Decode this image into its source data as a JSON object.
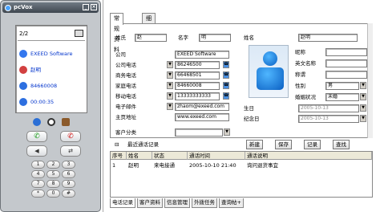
{
  "phone": {
    "app_title": "pcVox",
    "page_indicator": "2/2",
    "contacts": [
      {
        "label": "EXEED Software",
        "icon": "globe-icon",
        "color": "#2255ee"
      },
      {
        "label": "赵明",
        "icon": "contact-icon",
        "color": "#cc3333"
      },
      {
        "label": "84660008",
        "icon": "phone-icon",
        "color": "#2266dd"
      },
      {
        "label": "00:00:35",
        "icon": "clock-icon",
        "color": "#2266dd"
      }
    ],
    "keys": [
      "1",
      "2",
      "3",
      "4",
      "5",
      "6",
      "7",
      "8",
      "9",
      "*",
      "0",
      "#"
    ]
  },
  "tabs": [
    "常规资料",
    "细节资料"
  ],
  "form": {
    "salutation_label": "姓氏",
    "salutation_value": "赵",
    "given_label": "名字",
    "given_value": "明",
    "fullname_label": "姓名",
    "fullname_value": "赵明",
    "company_label": "公司",
    "company_value": "EXEED Software",
    "office_phone_label": "公司电话",
    "office_phone_value": "86246500",
    "business_phone_label": "商务电话",
    "business_phone_value": "66468501",
    "home_phone_label": "家庭电话",
    "home_phone_value": "84660008",
    "mobile_label": "移动电话",
    "mobile_value": "13333333333",
    "email_label": "电子邮件",
    "email_value": "zhaom@exeed.com",
    "homepage_label": "主页地址",
    "homepage_value": "www.exeed.com",
    "nickname_label": "昵称",
    "english_name_label": "英文名称",
    "title_label": "称谓",
    "gender_label": "性别",
    "gender_value": "男",
    "marital_label": "婚姻状况",
    "marital_value": "未婚",
    "birthday_label": "生日",
    "birthday_value": "2005-10-13",
    "anniversary_label": "纪念日",
    "anniversary_value": "2005-10-13",
    "category_label": "客户分类"
  },
  "toolbar": {
    "recent_label": "最近通话记录",
    "new_label": "新建",
    "save_label": "保存",
    "record_label": "记录",
    "query_label": "查找"
  },
  "table": {
    "headers": [
      "序号",
      "姓名",
      "状态",
      "通话时间",
      "通话说明"
    ],
    "rows": [
      [
        "1",
        "赵明",
        "来电接通",
        "2005-10-10 21:40",
        "询问退货事宜"
      ]
    ]
  },
  "bottom_tabs": [
    "电话记录",
    "客户资料",
    "信息管理",
    "外拨任务",
    "查询帖+"
  ]
}
